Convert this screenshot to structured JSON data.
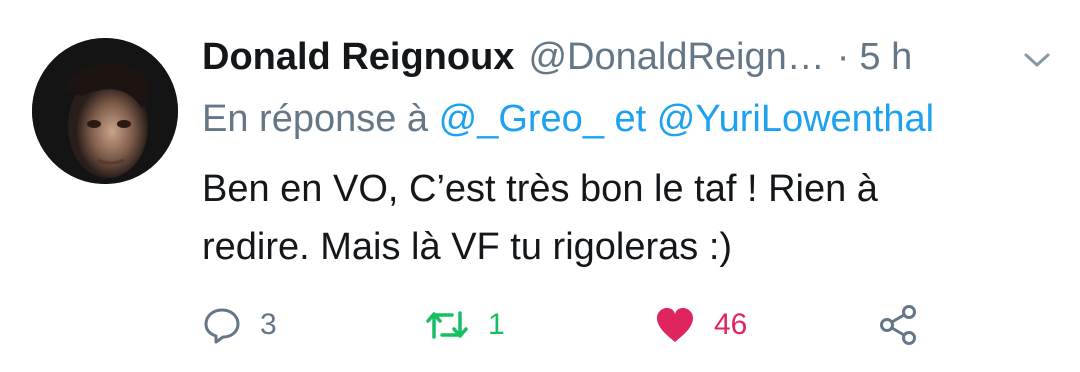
{
  "tweet": {
    "author_name": "Donald Reignoux",
    "author_handle": "@DonaldReign…",
    "separator": "·",
    "timestamp": "5 h",
    "reply_prefix": "En réponse à",
    "reply_mention_1": "@_Greo_",
    "reply_conjunction": "et",
    "reply_mention_2": "@YuriLowenthal",
    "text_line_1": "Ben en VO, C’est très bon le taf ! Rien à",
    "text_line_2": "redire. Mais là VF tu rigoleras :)"
  },
  "actions": {
    "reply_icon": "reply-bubble-icon",
    "reply_count": "3",
    "retweet_icon": "retweet-arrows-icon",
    "retweet_count": "1",
    "like_icon": "heart-icon",
    "like_count": "46",
    "share_icon": "share-icon"
  },
  "colors": {
    "text_primary": "#14171a",
    "text_secondary": "#657786",
    "link": "#1da1f2",
    "retweet_active": "#17bf63",
    "like_active": "#e0245e"
  }
}
